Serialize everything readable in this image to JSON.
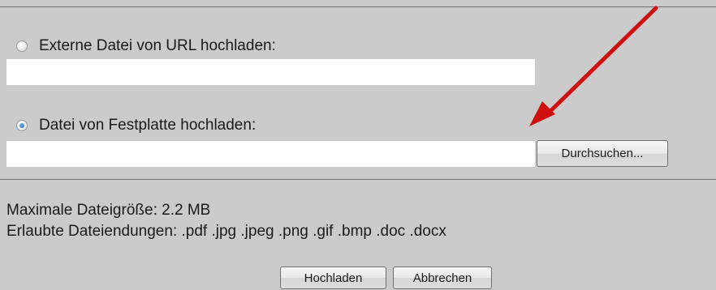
{
  "upload_form": {
    "url_option": {
      "label": "Externe Datei von URL hochladen:",
      "selected": false,
      "input_value": ""
    },
    "file_option": {
      "label": "Datei von Festplatte hochladen:",
      "selected": true,
      "input_value": "",
      "browse_label": "Durchsuchen..."
    },
    "info": {
      "max_size": "Maximale Dateigröße: 2.2 MB",
      "allowed_extensions": "Erlaubte Dateiendungen: .pdf .jpg .jpeg .png .gif .bmp .doc .docx"
    },
    "actions": {
      "upload_label": "Hochladen",
      "cancel_label": "Abbrechen"
    }
  },
  "annotation": {
    "arrow_color": "#d01010"
  },
  "colors": {
    "background": "#cbcbcb",
    "divider": "#6f6f6f",
    "input_background": "#ffffff"
  }
}
